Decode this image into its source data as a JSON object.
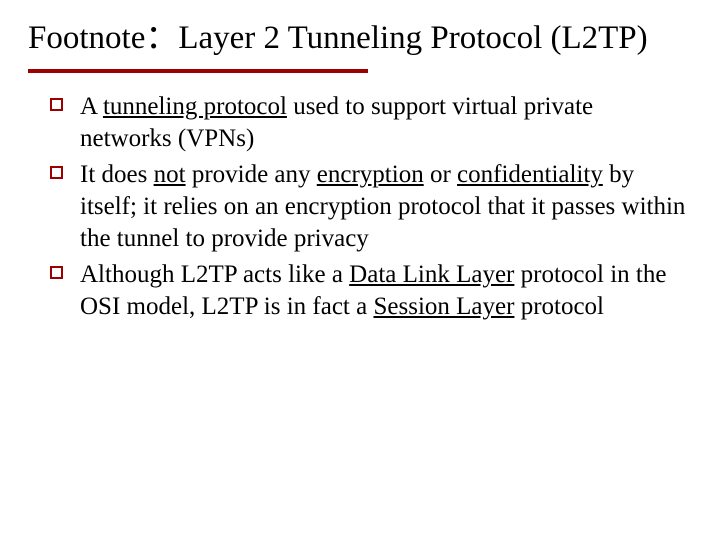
{
  "title": "Footnote：Layer 2 Tunneling Protocol (L2TP)",
  "bullets": {
    "b1": {
      "p1": "A ",
      "u1": "tunneling protocol",
      "p2": " used to support virtual private networks (VPNs)"
    },
    "b2": {
      "p1": "It does ",
      "u1": "not",
      "p2": " provide any ",
      "u2": "encryption",
      "p3": " or ",
      "u3": "confidentiality",
      "p4": " by itself; it relies on an encryption protocol that it passes within the tunnel to provide privacy"
    },
    "b3": {
      "p1": "Although L2TP acts like a ",
      "u1": "Data Link Layer",
      "p2": " protocol in the OSI model, L2TP is in fact a ",
      "u2": "Session Layer",
      "p3": " protocol"
    }
  }
}
